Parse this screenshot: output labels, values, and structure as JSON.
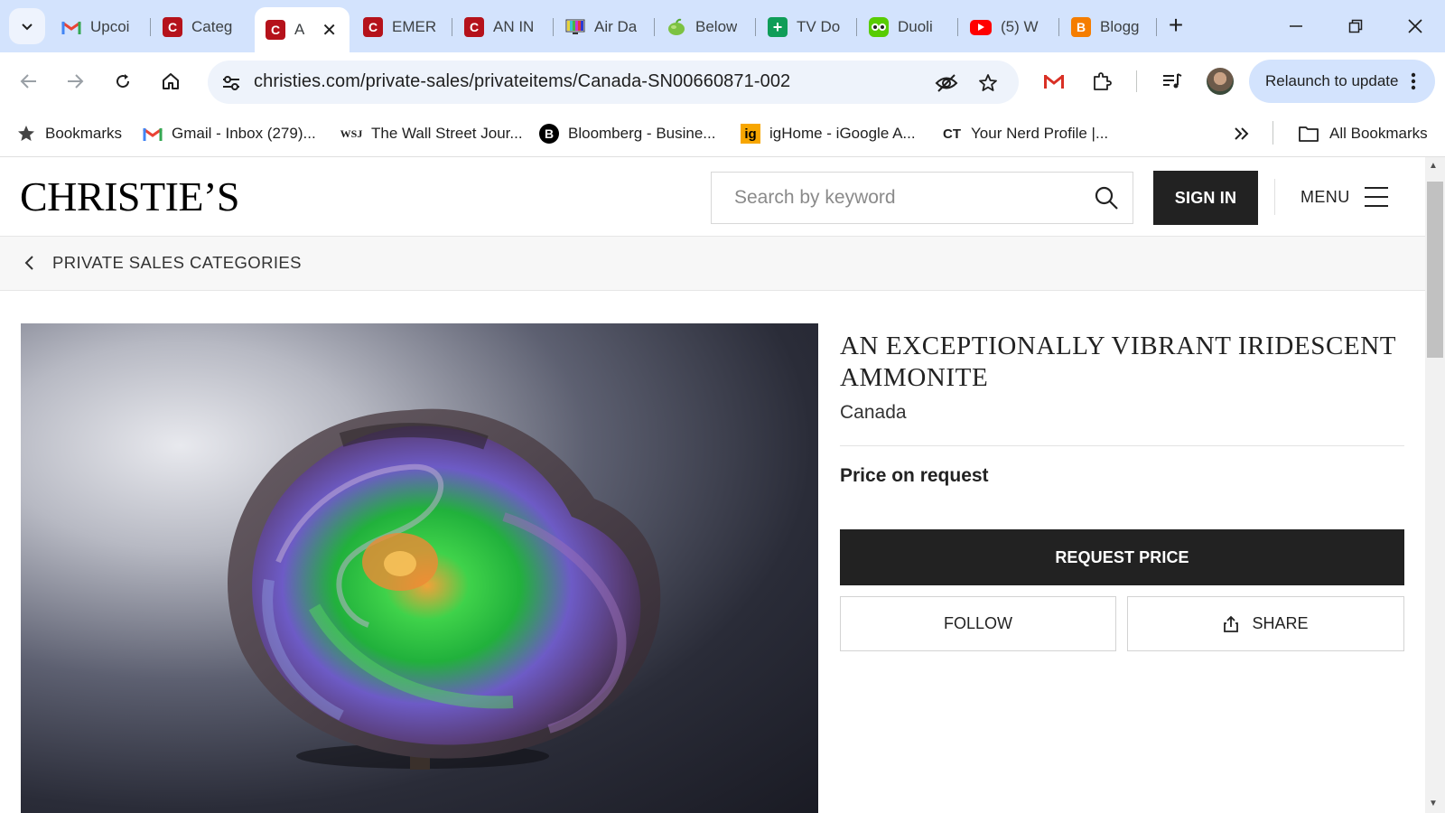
{
  "browser": {
    "tabs": [
      {
        "label": "Upcoi",
        "icon": "gmail-icon"
      },
      {
        "label": "Categ",
        "icon": "christies-icon"
      },
      {
        "label": "A",
        "icon": "christies-icon",
        "active": true
      },
      {
        "label": "EMER",
        "icon": "christies-icon"
      },
      {
        "label": "AN IN",
        "icon": "christies-icon"
      },
      {
        "label": "Air Da",
        "icon": "tv-icon"
      },
      {
        "label": "Below",
        "icon": "apple-icon"
      },
      {
        "label": "TV Do",
        "icon": "sheets-icon"
      },
      {
        "label": "Duoli",
        "icon": "duolingo-icon"
      },
      {
        "label": "(5) W",
        "icon": "youtube-icon"
      },
      {
        "label": "Blogg",
        "icon": "blogger-icon"
      }
    ],
    "url": "christies.com/private-sales/privateitems/Canada-SN00660871-002",
    "relaunch_label": "Relaunch to update",
    "bookmarks": [
      {
        "label": "Bookmarks",
        "icon": "star-icon"
      },
      {
        "label": "Gmail - Inbox (279)...",
        "icon": "gmail-icon"
      },
      {
        "label": "The Wall Street Jour...",
        "icon": "wsj-icon"
      },
      {
        "label": "Bloomberg - Busine...",
        "icon": "bloomberg-icon"
      },
      {
        "label": "igHome - iGoogle A...",
        "icon": "ighome-icon"
      },
      {
        "label": "Your Nerd Profile |...",
        "icon": "ct-icon"
      }
    ],
    "all_bookmarks_label": "All Bookmarks",
    "icon_glyphs": {
      "wsj": "WSJ",
      "bloomberg": "B",
      "ighome": "ig",
      "ct": "CT"
    }
  },
  "site": {
    "logo": "CHRISTIE’S",
    "search_placeholder": "Search by keyword",
    "sign_in_label": "SIGN IN",
    "menu_label": "MENU"
  },
  "breadcrumb": {
    "label": "PRIVATE SALES CATEGORIES"
  },
  "lot": {
    "title": "AN EXCEPTIONALLY VIBRANT IRIDESCENT AMMONITE",
    "origin": "Canada",
    "price": "Price on request",
    "request_label": "REQUEST PRICE",
    "follow_label": "FOLLOW",
    "share_label": "SHARE"
  },
  "colors": {
    "tabstrip": "#d3e3fd",
    "button_dark": "#222222",
    "christies_red": "#b5121b"
  }
}
